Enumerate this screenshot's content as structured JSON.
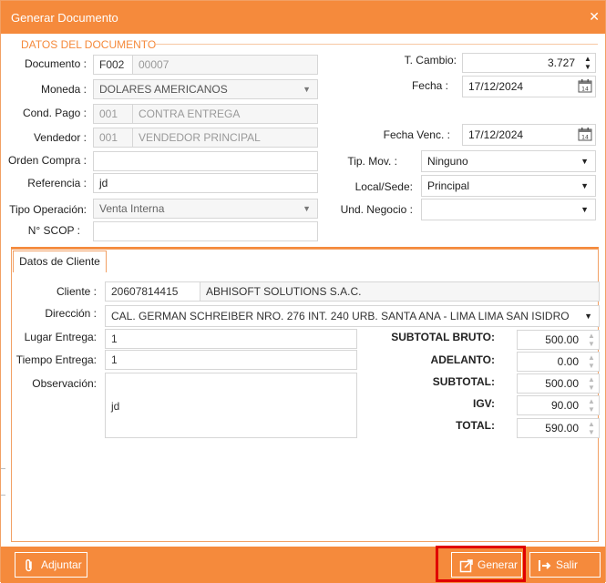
{
  "window": {
    "title": "Generar Documento",
    "close_glyph": "✕"
  },
  "section_title": "DATOS DEL DOCUMENTO",
  "form": {
    "documento": {
      "label": "Documento :",
      "serie": "F002",
      "numero": "00007"
    },
    "moneda": {
      "label": "Moneda :",
      "value": "DOLARES AMERICANOS"
    },
    "cond_pago": {
      "label": "Cond. Pago :",
      "code": "001",
      "desc": "CONTRA ENTREGA"
    },
    "vendedor": {
      "label": "Vendedor :",
      "code": "001",
      "desc": "VENDEDOR PRINCIPAL"
    },
    "orden_compra": {
      "label": "Orden Compra :",
      "value": ""
    },
    "referencia": {
      "label": "Referencia :",
      "value": "jd"
    },
    "tipo_operacion": {
      "label": "Tipo Operación:",
      "value": "Venta Interna"
    },
    "n_scop": {
      "label": "N° SCOP :",
      "value": ""
    },
    "t_cambio": {
      "label": "T. Cambio:",
      "value": "3.727"
    },
    "fecha": {
      "label": "Fecha :",
      "value": "17/12/2024"
    },
    "fecha_venc": {
      "label": "Fecha Venc. :",
      "value": "17/12/2024"
    },
    "tip_mov": {
      "label": "Tip. Mov. :",
      "value": "Ninguno"
    },
    "local_sede": {
      "label": "Local/Sede:",
      "value": "Principal"
    },
    "und_negocio": {
      "label": "Und. Negocio :",
      "value": ""
    }
  },
  "cliente_tab": {
    "tab_label": "Datos de Cliente",
    "cliente": {
      "label": "Cliente :",
      "ruc": "20607814415",
      "name": "ABHISOFT SOLUTIONS S.A.C."
    },
    "direccion": {
      "label": "Dirección :",
      "value": "CAL. GERMAN SCHREIBER NRO. 276 INT. 240 URB. SANTA ANA - LIMA LIMA SAN ISIDRO"
    },
    "lugar_entrega": {
      "label": "Lugar Entrega:",
      "value": "1"
    },
    "tiempo_entrega": {
      "label": "Tiempo Entrega:",
      "value": "1"
    },
    "observacion": {
      "label": "Observación:",
      "value": "jd"
    }
  },
  "totals": {
    "subtotal_bruto": {
      "label": "SUBTOTAL BRUTO:",
      "value": "500.00"
    },
    "adelanto": {
      "label": "ADELANTO:",
      "value": "0.00"
    },
    "subtotal": {
      "label": "SUBTOTAL:",
      "value": "500.00"
    },
    "igv": {
      "label": "IGV:",
      "value": "90.00"
    },
    "total": {
      "label": "TOTAL:",
      "value": "590.00"
    }
  },
  "footer": {
    "adjuntar_label": "Adjuntar",
    "generar_label": "Generar",
    "salir_label": "Salir"
  },
  "icons": {
    "paperclip": "paperclip-icon",
    "export": "export-icon",
    "exit": "exit-icon",
    "calendar": "calendar-icon"
  },
  "colors": {
    "accent": "#f58a3c",
    "highlight": "#e00000"
  }
}
